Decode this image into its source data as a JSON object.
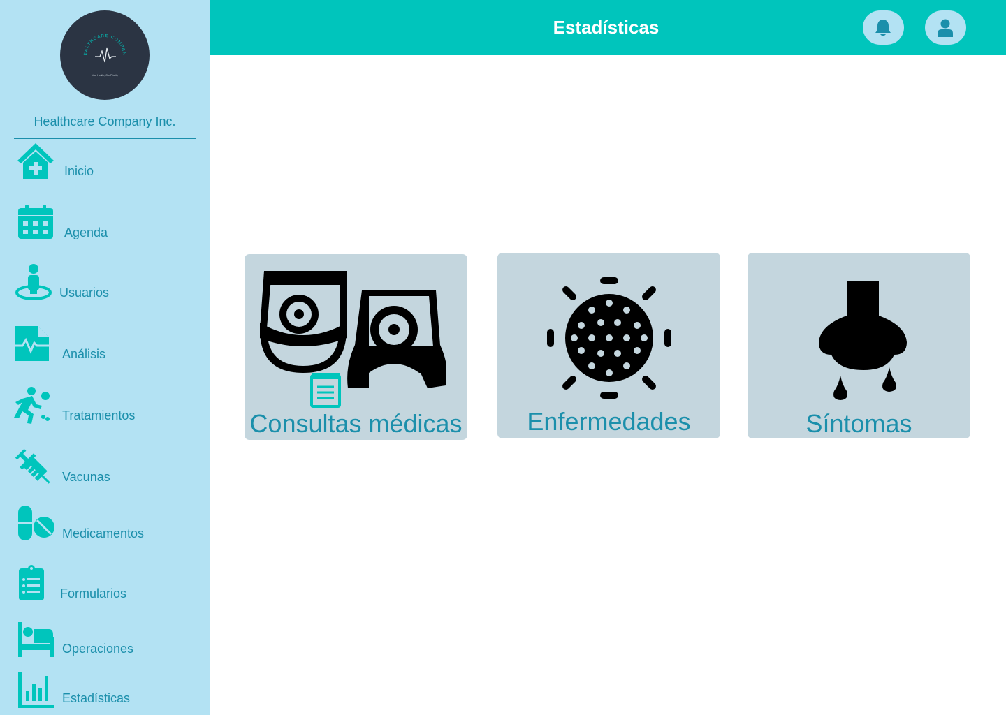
{
  "sidebar": {
    "logo": {
      "arc_text": "HEALTHCARE COMPANY",
      "tagline": "Your Health, Our Priority"
    },
    "company_name": "Healthcare Company Inc.",
    "items": [
      {
        "label": "Inicio",
        "icon": "home-medical-icon"
      },
      {
        "label": "Agenda",
        "icon": "calendar-icon"
      },
      {
        "label": "Usuarios",
        "icon": "user-location-icon"
      },
      {
        "label": "Análisis",
        "icon": "medical-file-icon"
      },
      {
        "label": "Tratamientos",
        "icon": "running-person-icon"
      },
      {
        "label": "Vacunas",
        "icon": "syringe-icon"
      },
      {
        "label": "Medicamentos",
        "icon": "pills-icon"
      },
      {
        "label": "Formularios",
        "icon": "clipboard-list-icon"
      },
      {
        "label": "Operaciones",
        "icon": "hospital-bed-icon"
      },
      {
        "label": "Estadísticas",
        "icon": "bar-chart-icon"
      }
    ]
  },
  "header": {
    "title": "Estadísticas",
    "notifications_icon": "bell-icon",
    "profile_icon": "user-icon"
  },
  "cards": [
    {
      "label": "Consultas médicas",
      "icon": "doctors-report-icon"
    },
    {
      "label": "Enfermedades",
      "icon": "virus-icon"
    },
    {
      "label": "Síntomas",
      "icon": "runny-nose-icon"
    }
  ],
  "colors": {
    "sidebar_bg": "#b3e2f3",
    "header_bg": "#00c5bc",
    "accent_icon": "#00c5bc",
    "text_accent": "#1b8fab",
    "card_bg": "#c4d6de",
    "logo_bg": "#2b3443"
  }
}
